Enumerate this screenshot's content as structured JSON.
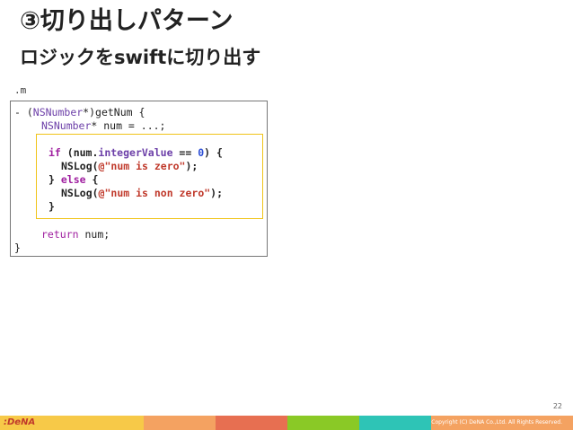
{
  "slide": {
    "title": "③切り出しパターン",
    "subtitle": "ロジックをswiftに切り出す",
    "file_label": ".m",
    "page_number": "22",
    "logo_text": ":DeNA",
    "copyright": "Copyright (C) DeNA Co.,Ltd. All Rights Reserved."
  },
  "code": {
    "l1_a": "- (",
    "l1_type": "NSNumber",
    "l1_b": "*)getNum {",
    "l2_type": "NSNumber",
    "l2_b": "* num = ...;",
    "l3_kw": "if",
    "l3_a": " (num.",
    "l3_prop": "integerValue",
    "l3_b": " == ",
    "l3_num": "0",
    "l3_c": ") {",
    "l4_a": "NSLog(",
    "l4_str": "@\"num is zero\"",
    "l4_b": ");",
    "l5_a": "} ",
    "l5_kw": "else",
    "l5_b": " {",
    "l6_a": "NSLog(",
    "l6_str": "@\"num is non zero\"",
    "l6_b": ");",
    "l7": "}",
    "l8_kw": "return",
    "l8_b": " num;",
    "l9": "}"
  },
  "colors": {
    "footer_segments": [
      "#f7c948",
      "#f7c948",
      "#f4a261",
      "#e76f51",
      "#8ac926",
      "#2ec4b6",
      "#f4a261"
    ]
  }
}
